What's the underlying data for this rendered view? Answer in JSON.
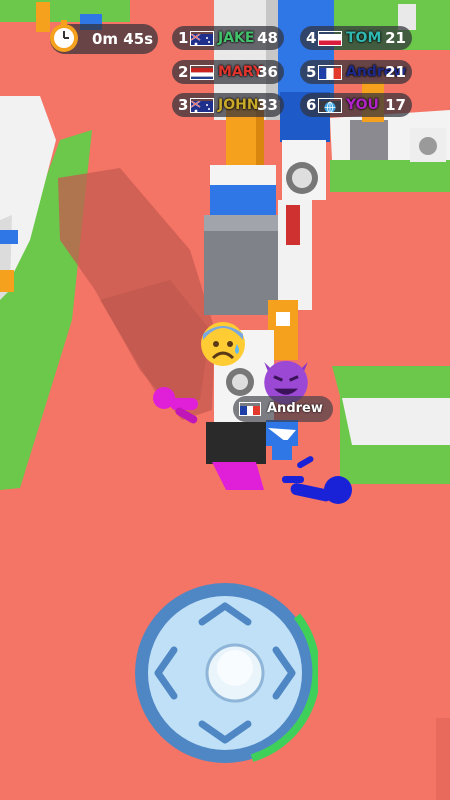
{
  "hud": {
    "timer": "0m 45s",
    "timer_icon": "stopwatch-icon"
  },
  "leaderboard": [
    {
      "rank": "1",
      "name": "JAKE",
      "score": "48",
      "flag": "australia",
      "color": "#42c26a"
    },
    {
      "rank": "2",
      "name": "MARY",
      "score": "36",
      "flag": "netherlands",
      "color": "#e0342c"
    },
    {
      "rank": "3",
      "name": "JOHN",
      "score": "33",
      "flag": "australia",
      "color": "#c9a92a"
    },
    {
      "rank": "4",
      "name": "TOM",
      "score": "21",
      "flag": "poland",
      "color": "#2fb9b0"
    },
    {
      "rank": "5",
      "name": "Andrew",
      "score": "21",
      "flag": "france",
      "color": "#1e2a8c"
    },
    {
      "rank": "6",
      "name": "YOU",
      "score": "17",
      "flag": "globe",
      "color": "#b023c8"
    }
  ],
  "player_tag": {
    "name": "Andrew",
    "flag": "france"
  },
  "emotes": {
    "scared": "anxious-face-emoji",
    "devil": "smiling-devil-emoji"
  },
  "colors": {
    "ground": "#f47466",
    "grass": "#6cc84a",
    "player_magenta": "#e020d8",
    "player_blue": "#1a22d8",
    "joystick_ring": "#3fd05a"
  }
}
